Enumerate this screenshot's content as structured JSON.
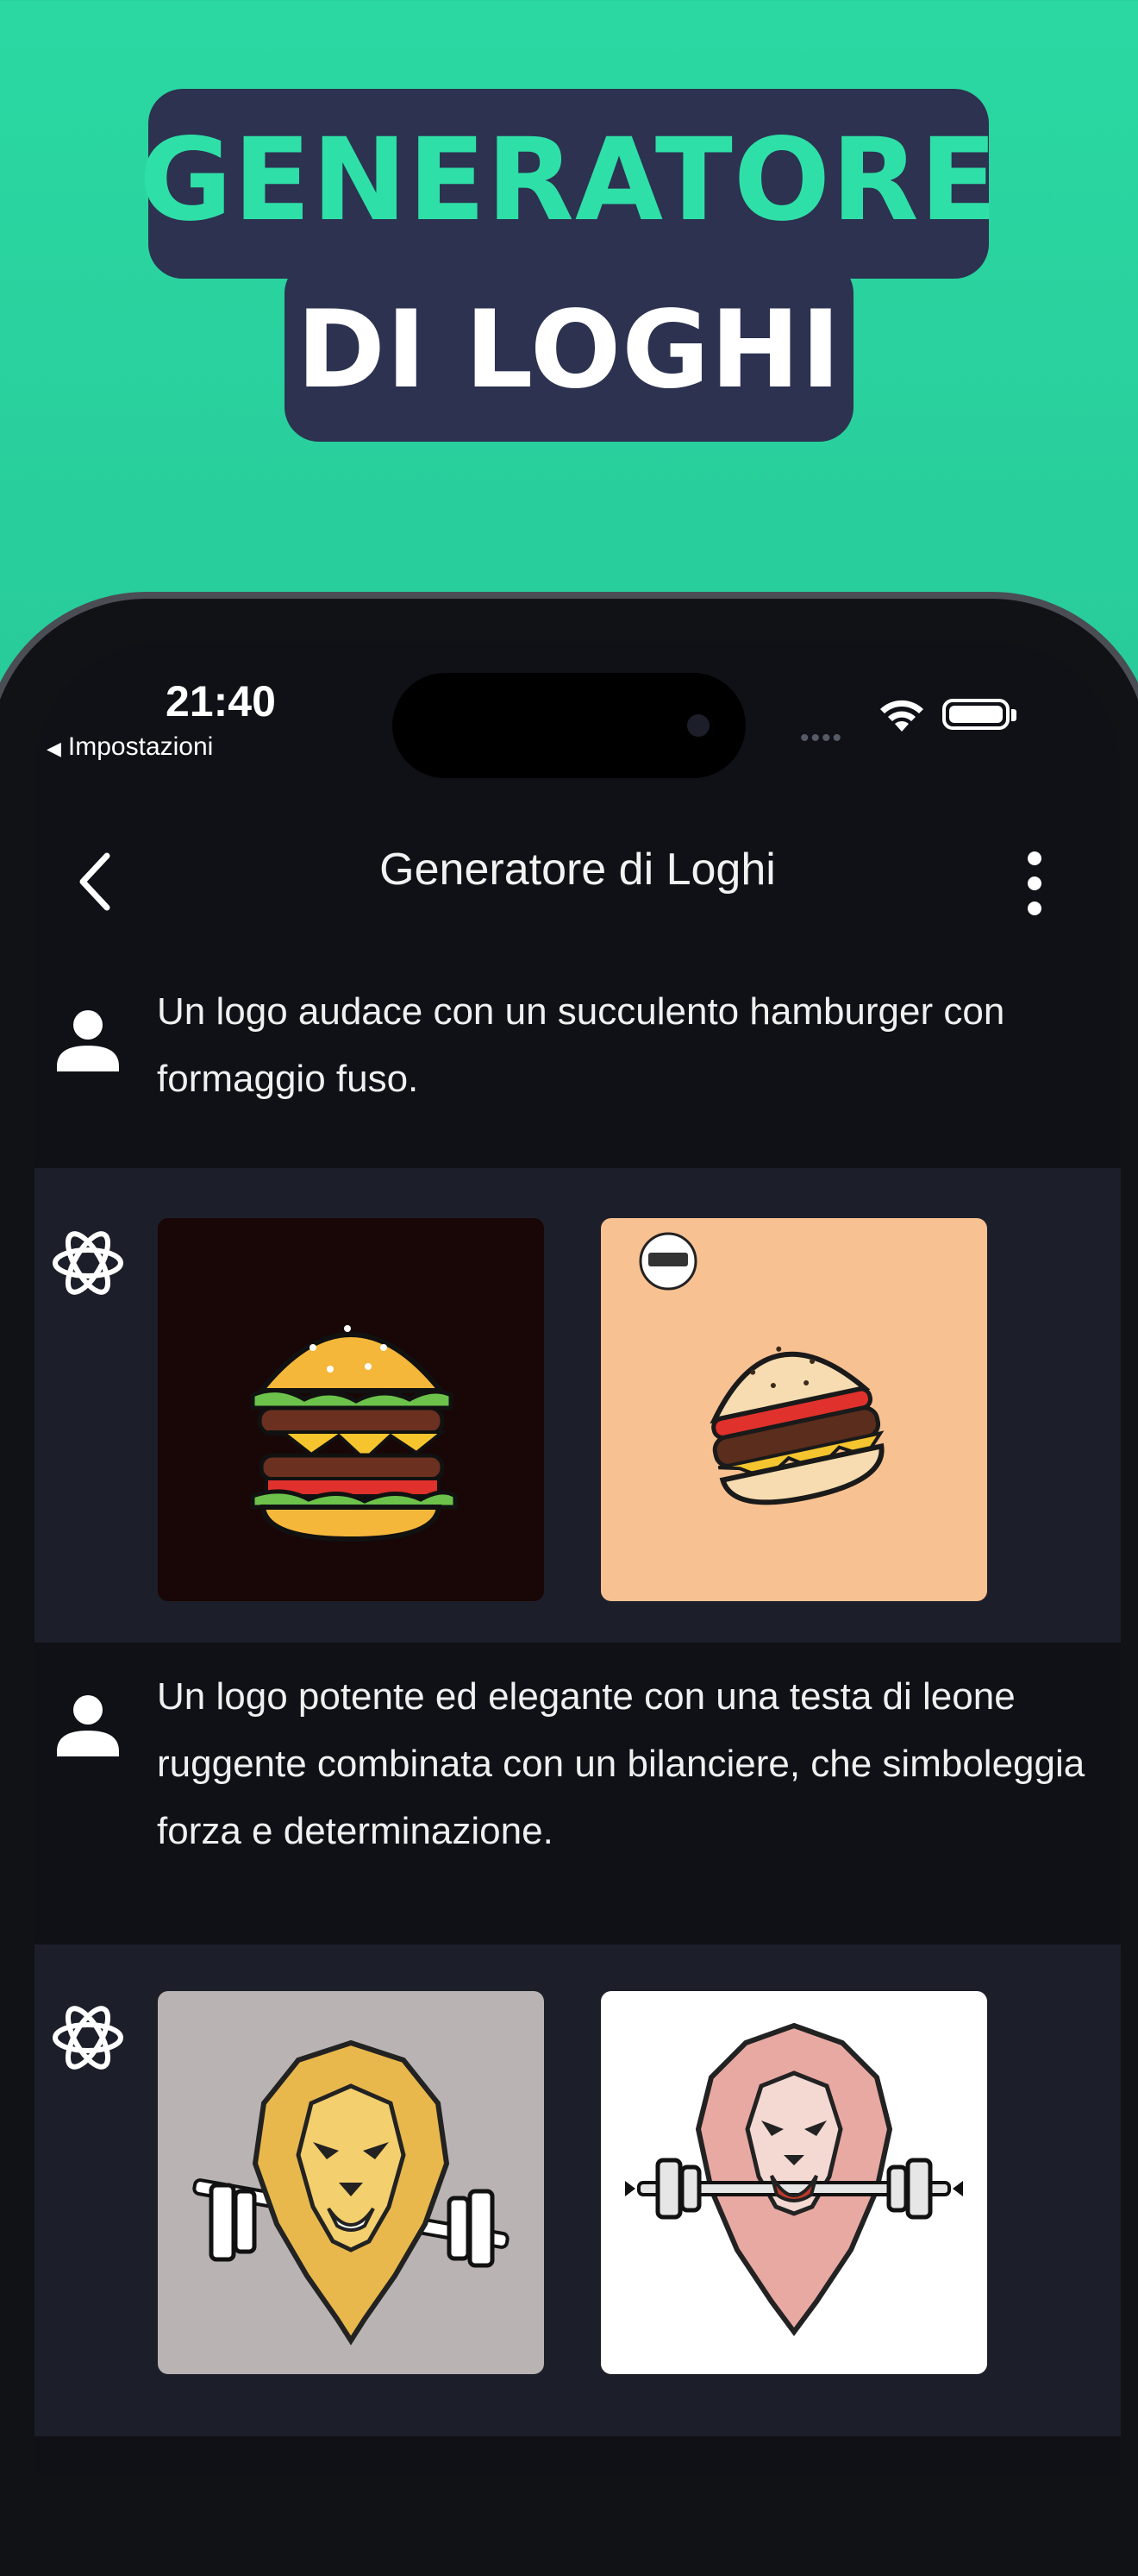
{
  "promo": {
    "headline_line1": "GENERATORE",
    "headline_line2": "DI LOGHI",
    "accent_color": "#2ee0a8",
    "badge_color": "#2c3250"
  },
  "status_bar": {
    "time": "21:40",
    "back_app_label": "Impostazioni",
    "back_app_icon": "back-triangle-icon",
    "wifi_icon": "wifi-icon",
    "battery_icon": "battery-icon"
  },
  "navbar": {
    "title": "Generatore di Loghi",
    "back_icon": "chevron-left-icon",
    "more_icon": "more-vertical-icon"
  },
  "messages": [
    {
      "role": "user",
      "icon": "user-icon",
      "text": "Un logo audace con un succulento hamburger con formaggio fuso."
    },
    {
      "role": "assistant",
      "icon": "ai-knot-icon",
      "images": [
        {
          "name": "burger-logo-dark",
          "background": "#190606"
        },
        {
          "name": "burger-logo-peach",
          "background": "#f8c192"
        }
      ]
    },
    {
      "role": "user",
      "icon": "user-icon",
      "text": "Un logo potente ed elegante con una testa di leone ruggente combinata con un bilanciere, che simboleggia forza e determinazione."
    },
    {
      "role": "assistant",
      "icon": "ai-knot-icon",
      "images": [
        {
          "name": "lion-barbell-logo-gold",
          "background": "#b9b3b3"
        },
        {
          "name": "lion-barbell-logo-pink",
          "background": "#ffffff"
        }
      ]
    }
  ]
}
